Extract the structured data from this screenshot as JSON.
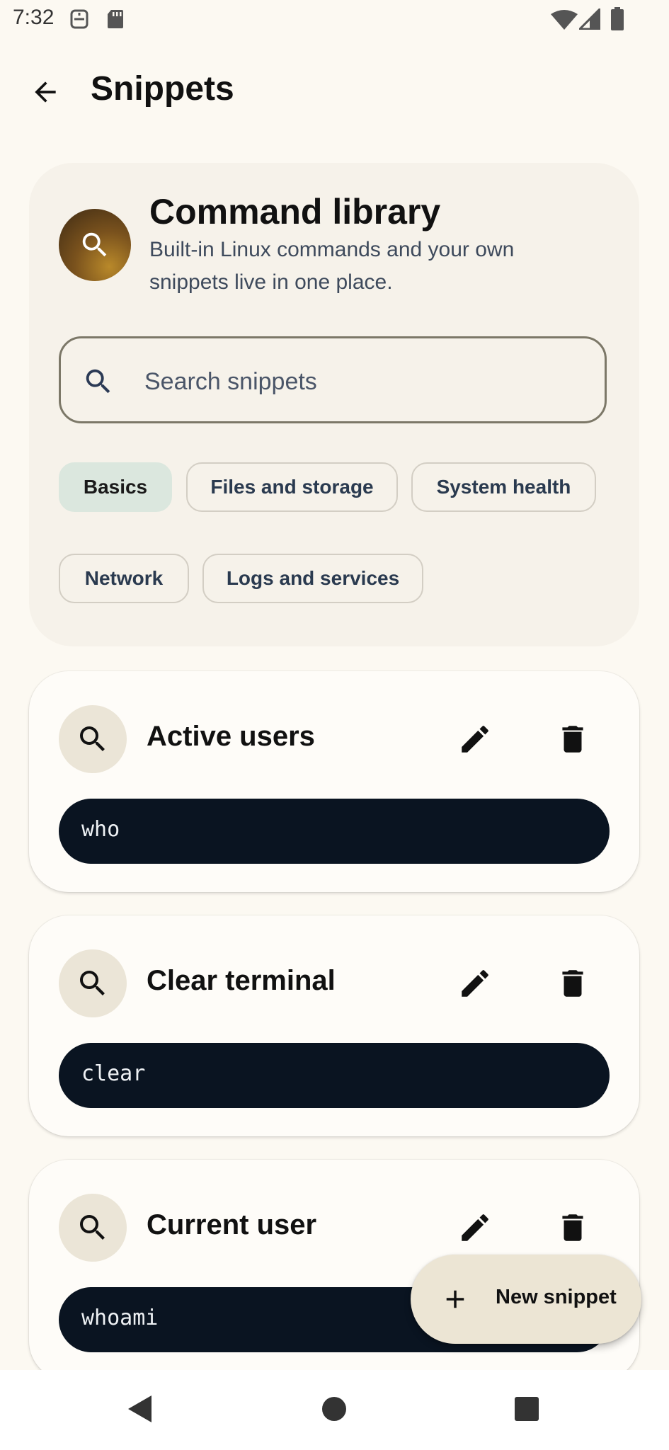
{
  "status_bar": {
    "time": "7:32",
    "left_icons": [
      "dnd-icon",
      "sd-card-icon"
    ],
    "right_icons": [
      "wifi-icon",
      "signal-icon",
      "battery-icon"
    ]
  },
  "app_bar": {
    "back_icon": "arrow-back-icon",
    "title": "Snippets"
  },
  "hero": {
    "icon": "search-icon",
    "title": "Command library",
    "subtitle": "Built-in Linux commands and your own snippets live in one place.",
    "search": {
      "placeholder": "Search snippets",
      "value": ""
    },
    "chips": [
      {
        "label": "Basics",
        "selected": true
      },
      {
        "label": "Files and storage",
        "selected": false
      },
      {
        "label": "System health",
        "selected": false
      },
      {
        "label": "Network",
        "selected": false
      },
      {
        "label": "Logs and services",
        "selected": false
      }
    ]
  },
  "snippets": [
    {
      "title": "Active users",
      "command": "who"
    },
    {
      "title": "Clear terminal",
      "command": "clear"
    },
    {
      "title": "Current user",
      "command": "whoami"
    }
  ],
  "fab": {
    "icon": "plus-icon",
    "label": "New snippet"
  },
  "nav_bar": {
    "buttons": [
      "back-triangle-icon",
      "home-circle-icon",
      "recents-square-icon"
    ]
  },
  "colors": {
    "background": "#fcf9f2",
    "hero_background": "#f6f2ea",
    "selected_chip": "#dbe7de",
    "command_background": "#0a1421",
    "fab_background": "#ece5d4"
  }
}
